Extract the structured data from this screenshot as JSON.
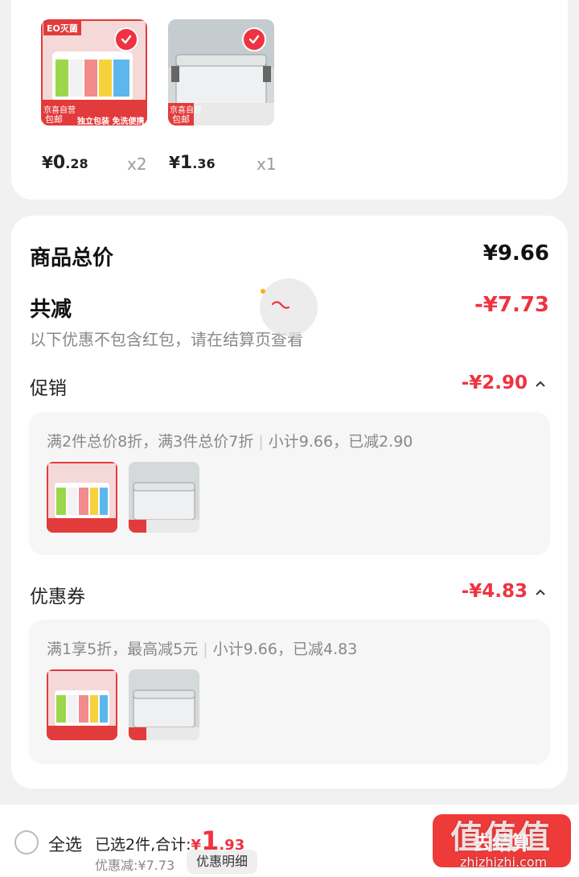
{
  "cart_items": [
    {
      "price_currency": "¥",
      "price_int": "0",
      "price_dec": ".28",
      "qty": "x2",
      "brand_tag": "EO灭菌",
      "badge_top": "京喜自营",
      "badge_bottom": "包邮",
      "banner": "独立包装 免洗便携"
    },
    {
      "price_currency": "¥",
      "price_int": "1",
      "price_dec": ".36",
      "qty": "x1",
      "badge_top": "京喜自营",
      "badge_bottom": "包邮"
    }
  ],
  "summary": {
    "total_label": "商品总价",
    "total_value": "¥9.66",
    "reduce_label": "共减",
    "reduce_value": "-¥7.73",
    "reduce_hint": "以下优惠不包含红包，请在结算页查看"
  },
  "promotion": {
    "label": "促销",
    "amount": "-¥2.90",
    "rule": "满2件总价8折，满3件总价7折",
    "detail": "小计9.66，已减2.90"
  },
  "coupon": {
    "label": "优惠券",
    "amount": "-¥4.83",
    "rule": "满1享5折，最高减5元",
    "detail": "小计9.66，已减4.83"
  },
  "footer": {
    "select_all": "全选",
    "selected_text": "已选2件,合计:",
    "total_currency": "¥",
    "total_int": "1",
    "total_dec": ".93",
    "discount_text": "优惠减:¥7.73",
    "detail_button": "优惠明细",
    "checkout_button": "去结算"
  },
  "watermark": {
    "main": "值值值",
    "sub": "zhizhizhi.com"
  },
  "colors": {
    "accent": "#ef3340",
    "background": "#f1f1f1"
  }
}
